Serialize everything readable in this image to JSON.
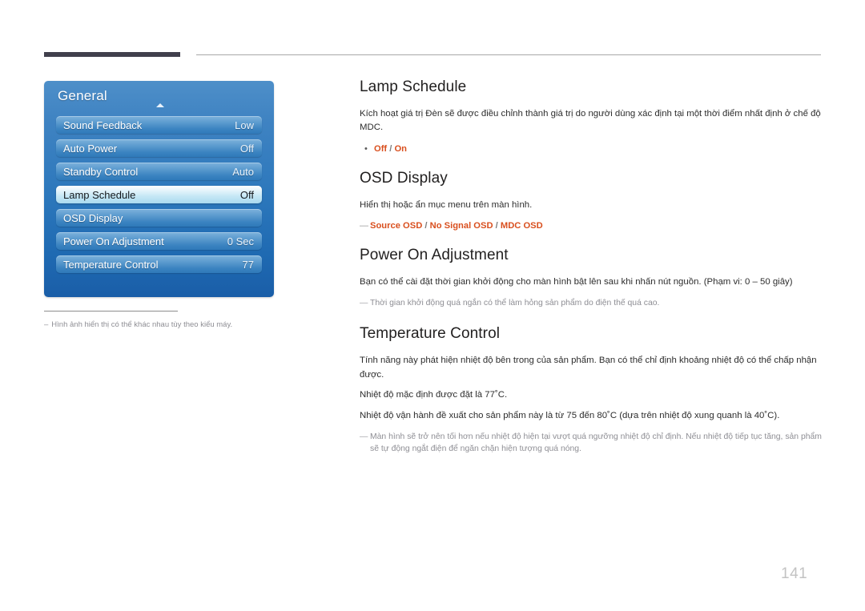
{
  "page_number": "141",
  "colors": {
    "accent_orange": "#d94f1e",
    "menu_blue": "#2d78bc",
    "note_gray": "#8e8e94",
    "header_bar_dark": "#403f4c"
  },
  "osd_menu": {
    "title": "General",
    "scroll_up_icon": "triangle-up-icon",
    "rows": [
      {
        "label": "Sound Feedback",
        "value": "Low",
        "selected": false
      },
      {
        "label": "Auto Power",
        "value": "Off",
        "selected": false
      },
      {
        "label": "Standby Control",
        "value": "Auto",
        "selected": false
      },
      {
        "label": "Lamp Schedule",
        "value": "Off",
        "selected": true
      },
      {
        "label": "OSD Display",
        "value": "",
        "selected": false
      },
      {
        "label": "Power On Adjustment",
        "value": "0 Sec",
        "selected": false
      },
      {
        "label": "Temperature Control",
        "value": "77",
        "selected": false
      }
    ],
    "footnote": {
      "marker": "–",
      "text": "Hình ảnh hiển thị có thể khác nhau tùy theo kiểu máy."
    }
  },
  "sections": [
    {
      "title": "Lamp Schedule",
      "paragraphs": [
        "Kích hoạt giá trị Đèn sẽ được điều chỉnh thành giá trị do người dùng xác định tại một thời điểm nhất định ở chế độ MDC."
      ],
      "options": {
        "marker": "•",
        "items": [
          "Off",
          "On"
        ],
        "separator": " / "
      },
      "notes": []
    },
    {
      "title": "OSD Display",
      "paragraphs": [
        "Hiển thị hoặc ẩn mục menu trên màn hình."
      ],
      "options": {
        "marker": "—",
        "items": [
          "Source OSD",
          "No Signal OSD",
          "MDC OSD"
        ],
        "separator": " / "
      },
      "notes": []
    },
    {
      "title": "Power On Adjustment",
      "paragraphs": [
        "Bạn có thể cài đặt thời gian khởi động cho màn hình bật lên sau khi nhấn nút nguồn. (Phạm vi: 0 – 50 giây)"
      ],
      "options": null,
      "notes": [
        "Thời gian khởi động quá ngắn có thể làm hỏng sản phẩm do điện thế quá cao."
      ]
    },
    {
      "title": "Temperature Control",
      "paragraphs": [
        "Tính năng này phát hiện nhiệt độ bên trong của sản phẩm. Bạn có thể chỉ định khoảng nhiệt độ có thể chấp nhận được.",
        "Nhiệt độ mặc định được đặt là 77˚C.",
        "Nhiệt độ vận hành đề xuất cho sản phẩm này là từ 75 đến 80˚C (dựa trên nhiệt độ xung quanh là 40˚C)."
      ],
      "options": null,
      "notes": [
        "Màn hình sẽ trở nên tối hơn nếu nhiệt độ hiện tại vượt quá ngưỡng nhiệt độ chỉ định. Nếu nhiệt độ tiếp tục tăng, sản phẩm sẽ tự động ngắt điện để ngăn chặn hiện tượng quá nóng."
      ]
    }
  ]
}
